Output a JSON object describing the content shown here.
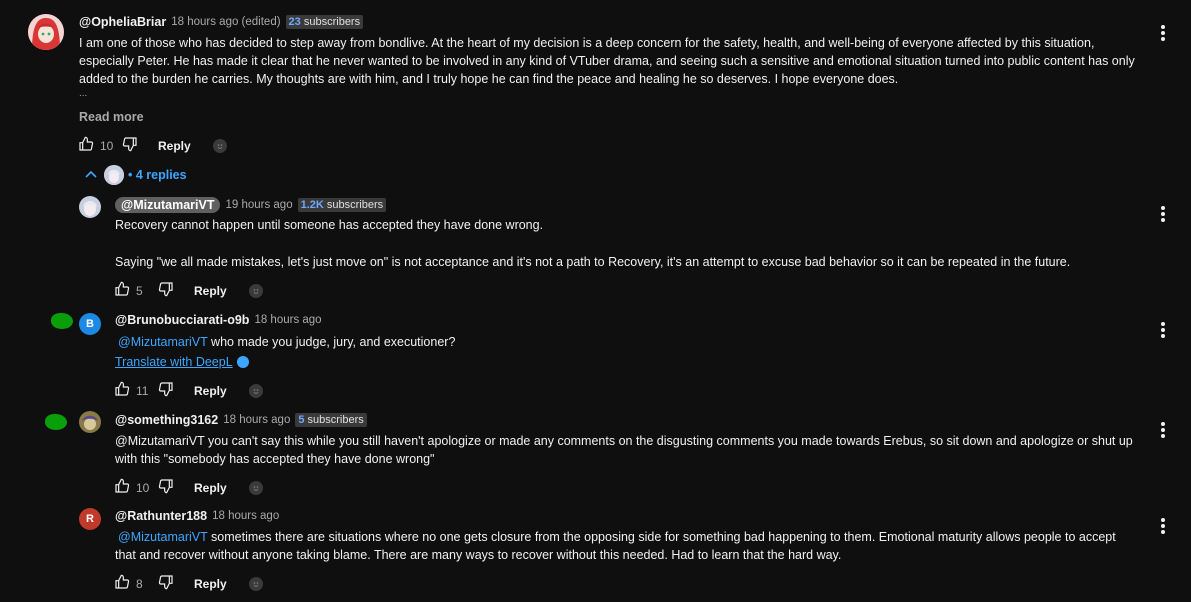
{
  "main": {
    "author": "@OpheliaBriar",
    "time": "18 hours ago (edited)",
    "subs_count": "23",
    "subs_label": "subscribers",
    "lines": [
      "I am one of those who has decided to step away from bondlive. At the heart of my decision is a deep concern for the safety, health, and well-being of everyone affected by this situation,",
      "especially Peter. He has made it clear that he never wanted to be involved in any kind of VTuber drama, and seeing such a sensitive and emotional situation turned into public content has only",
      "added to the burden he carries. My thoughts are with him, and I truly hope he can find the peace and healing he so deserves. I hope everyone does.",
      "..."
    ],
    "read_more": "Read more",
    "likes": "10",
    "reply_label": "Reply",
    "replies_toggle": "• 4 replies",
    "colors": {
      "avatar_bg": "#d44",
      "accent": "#3ea6ff"
    }
  },
  "replies": [
    {
      "author": "@MizutamariVT",
      "time": "19 hours ago",
      "subs_count": "1.2K",
      "subs_label": "subscribers",
      "lines": [
        "Recovery cannot happen until someone has accepted they have done wrong.",
        "",
        "Saying \"we all made mistakes, let's just move on\" is not acceptance and it's not a path to Recovery, it's an attempt to excuse bad behavior so it can be repeated in the future."
      ],
      "likes": "5",
      "reply_label": "Reply"
    },
    {
      "author": "@Brunobucciarati-o9b",
      "time": "18 hours ago",
      "avatar_letter": "B",
      "mention": "@MizutamariVT",
      "text": " who made you judge, jury, and executioner?",
      "translate": "Translate with DeepL",
      "likes": "11",
      "reply_label": "Reply",
      "colors": {
        "avatar_bg": "#1e88e5"
      }
    },
    {
      "author": "@something3162",
      "time": "18 hours ago",
      "subs_count": "5",
      "subs_label": "subscribers",
      "line1_mention": "@MizutamariVT",
      "line1": "  you can't say this while you still haven't apologize or made any comments on the disgusting comments you made towards Erebus, so sit down and apologize or shut up",
      "line2": "with this \"somebody has accepted they have done wrong\"",
      "likes": "10",
      "reply_label": "Reply"
    },
    {
      "author": "@Rathunter188",
      "time": "18 hours ago",
      "avatar_letter": "R",
      "line1_mention": "@MizutamariVT",
      "line1": " sometimes there are situations where no one gets closure from the opposing side for something bad happening to them. Emotional maturity allows people to accept",
      "line2": "that and recover without anyone taking blame. There are many ways to recover without this needed. Had to learn that the hard way.",
      "likes": "8",
      "reply_label": "Reply",
      "colors": {
        "avatar_bg": "#c0392b"
      }
    }
  ],
  "icons": [
    "thumb-up-icon",
    "thumb-down-icon",
    "kebab-menu-icon",
    "chevron-up-icon",
    "deepl-icon"
  ]
}
